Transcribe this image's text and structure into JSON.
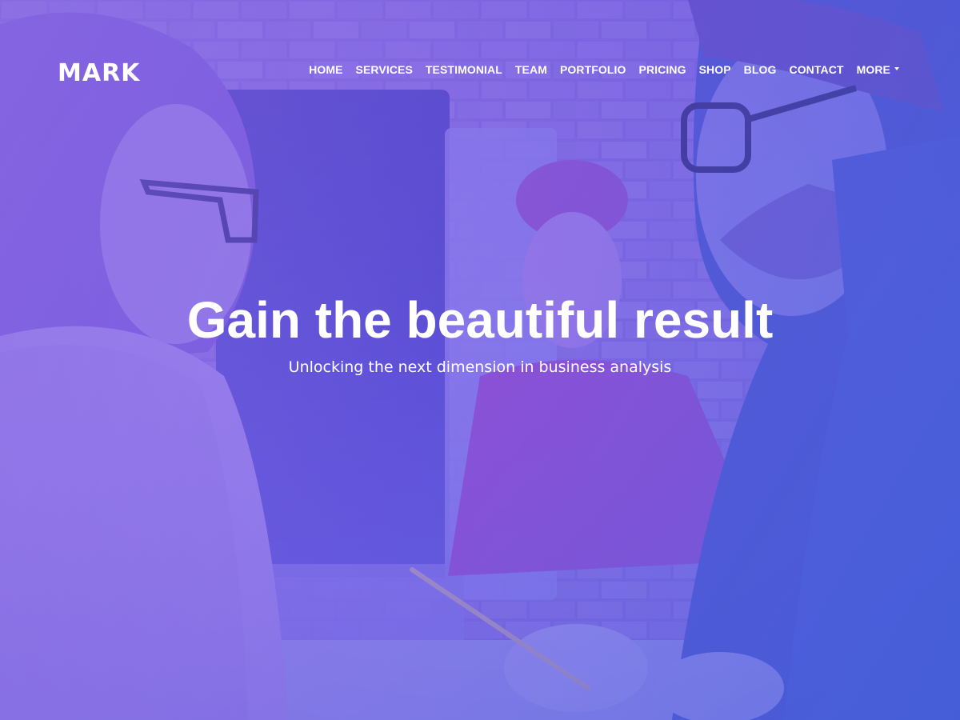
{
  "brand": {
    "logo_text": "MARK"
  },
  "nav": {
    "items": [
      {
        "label": "HOME"
      },
      {
        "label": "SERVICES"
      },
      {
        "label": "TESTIMONIAL"
      },
      {
        "label": "TEAM"
      },
      {
        "label": "PORTFOLIO"
      },
      {
        "label": "PRICING"
      },
      {
        "label": "SHOP"
      },
      {
        "label": "BLOG"
      },
      {
        "label": "CONTACT"
      },
      {
        "label": "MORE"
      }
    ]
  },
  "hero": {
    "title": "Gain the beautiful result",
    "subtitle": "Unlocking the next dimension in business analysis"
  },
  "colors": {
    "overlay_start": "#8b6fe0",
    "overlay_end": "#4f63de",
    "text": "#ffffff"
  }
}
